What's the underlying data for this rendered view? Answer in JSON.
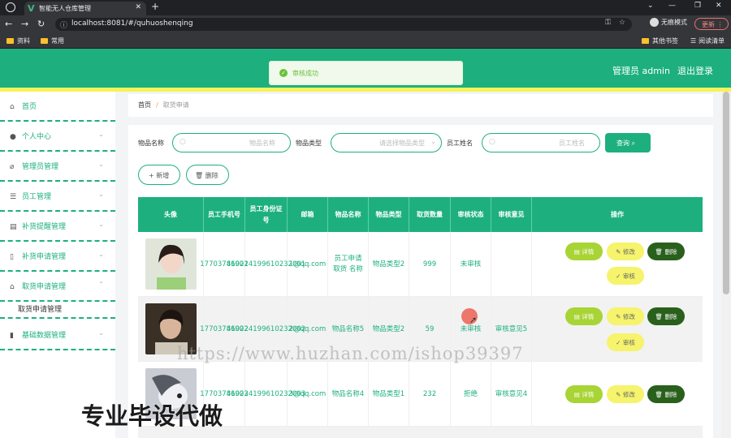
{
  "browser": {
    "tab_title": "智能无人仓库管理",
    "url": "localhost:8081/#/quhuoshenqing",
    "profile": "无痕模式",
    "update_label": "更新",
    "bookmarks": [
      "资料",
      "常用"
    ],
    "bookmarks_right": [
      "其他书签",
      "阅读清单"
    ]
  },
  "header": {
    "admin_label": "管理员 admin",
    "logout_label": "退出登录",
    "accent": "#1db07e",
    "strip": "#f5f35a"
  },
  "toast": {
    "message": "审核成功"
  },
  "sidebar": {
    "items": [
      {
        "label": "首页",
        "icon": "home-icon"
      },
      {
        "label": "个人中心",
        "icon": "user-icon"
      },
      {
        "label": "管理员管理",
        "icon": "admin-icon"
      },
      {
        "label": "员工管理",
        "icon": "list-icon"
      },
      {
        "label": "补货提醒管理",
        "icon": "clipboard-icon"
      },
      {
        "label": "补货申请管理",
        "icon": "phone-icon"
      },
      {
        "label": "取货申请管理",
        "icon": "bank-icon"
      },
      {
        "label": "基础数据管理",
        "icon": "chart-icon"
      }
    ],
    "sub_item": "取货申请管理"
  },
  "breadcrumb": {
    "home": "首页",
    "separator": "/",
    "current": "取货申请"
  },
  "filters": {
    "item_name_label": "物品名称",
    "item_name_placeholder": "物品名称",
    "item_type_label": "物品类型",
    "item_type_placeholder": "请选择物品类型",
    "staff_name_label": "员工姓名",
    "staff_name_placeholder": "员工姓名",
    "query_label": "查询"
  },
  "actions": {
    "add_label": "+ 新增",
    "delete_label": "删除"
  },
  "table": {
    "headers": [
      "头像",
      "员工手机号",
      "员工身份证号",
      "邮箱",
      "物品名称",
      "物品类型",
      "取货数量",
      "审核状态",
      "审核意见",
      "操作"
    ],
    "rows": [
      {
        "phone": "17703786901",
        "id_card": "410224199610232001",
        "email": "1@qq.com",
        "item_name": "员工申请取货 名称",
        "item_type": "物品类型2",
        "qty": "999",
        "status": "未审核",
        "opinion": ""
      },
      {
        "phone": "17703786902",
        "id_card": "410224199610232002",
        "email": "2@qq.com",
        "item_name": "物品名称5",
        "item_type": "物品类型2",
        "qty": "59",
        "status": "未审核",
        "opinion": "审核意见5"
      },
      {
        "phone": "17703786903",
        "id_card": "410224199610232003",
        "email": "3@qq.com",
        "item_name": "物品名称4",
        "item_type": "物品类型1",
        "qty": "232",
        "status": "拒绝",
        "opinion": "审核意见4"
      }
    ],
    "btn_detail": "详情",
    "btn_edit": "修改",
    "btn_delete": "删除",
    "btn_audit": "审核"
  },
  "watermark": "https://www.huzhan.com/ishop39397",
  "overlay": "专业毕设代做"
}
